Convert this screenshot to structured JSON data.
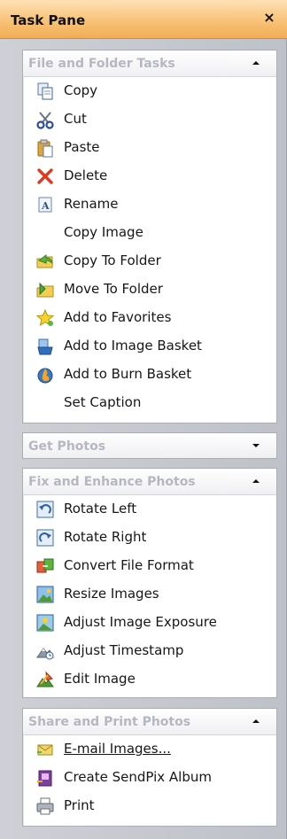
{
  "pane": {
    "title": "Task Pane",
    "close_glyph": "×"
  },
  "sections": [
    {
      "title": "File and Folder Tasks",
      "state": "expanded",
      "items": [
        {
          "label": "Copy",
          "icon": "copy-icon"
        },
        {
          "label": "Cut",
          "icon": "scissors-icon"
        },
        {
          "label": "Paste",
          "icon": "paste-icon"
        },
        {
          "label": "Delete",
          "icon": "delete-x-icon"
        },
        {
          "label": "Rename",
          "icon": "rename-icon"
        },
        {
          "label": "Copy Image",
          "icon": ""
        },
        {
          "label": "Copy To Folder",
          "icon": "folder-copy-icon"
        },
        {
          "label": "Move To Folder",
          "icon": "folder-move-icon"
        },
        {
          "label": "Add to Favorites",
          "icon": "star-icon"
        },
        {
          "label": "Add to Image Basket",
          "icon": "image-basket-icon"
        },
        {
          "label": "Add to Burn Basket",
          "icon": "burn-basket-icon"
        },
        {
          "label": "Set Caption",
          "icon": ""
        }
      ]
    },
    {
      "title": "Get Photos",
      "state": "collapsed",
      "items": []
    },
    {
      "title": "Fix and Enhance Photos",
      "state": "expanded",
      "items": [
        {
          "label": "Rotate Left",
          "icon": "rotate-left-icon"
        },
        {
          "label": "Rotate Right",
          "icon": "rotate-right-icon"
        },
        {
          "label": "Convert File Format",
          "icon": "convert-format-icon"
        },
        {
          "label": "Resize Images",
          "icon": "resize-images-icon"
        },
        {
          "label": "Adjust Image Exposure",
          "icon": "exposure-icon"
        },
        {
          "label": "Adjust Timestamp",
          "icon": "timestamp-icon"
        },
        {
          "label": "Edit Image",
          "icon": "edit-image-icon"
        }
      ]
    },
    {
      "title": "Share and Print Photos",
      "state": "expanded",
      "items": [
        {
          "label": "E-mail Images...",
          "icon": "email-envelope-icon"
        },
        {
          "label": "Create SendPix Album",
          "icon": "sendpix-album-icon"
        },
        {
          "label": "Print",
          "icon": "printer-icon"
        }
      ]
    }
  ],
  "colors": {
    "titlebar_orange": "#f8c277",
    "header_text_grey": "#b5b8c1",
    "pane_background": "#c5c7ce"
  }
}
